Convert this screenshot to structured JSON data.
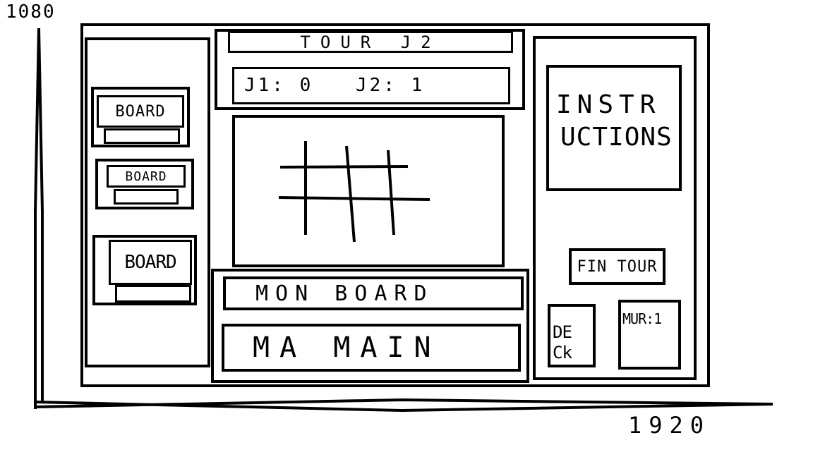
{
  "axes": {
    "y_label": "1080",
    "x_label": "1920"
  },
  "left_panel": {
    "boards": [
      {
        "label": "BOARD"
      },
      {
        "label": "BOARD"
      },
      {
        "label": "BOARD"
      }
    ]
  },
  "header": {
    "turn": "TOUR J2",
    "score_j1": "J1: 0",
    "score_j2": "J2: 1"
  },
  "bottom": {
    "my_board": "MON BOARD",
    "my_hand": "MA MAIN"
  },
  "right_panel": {
    "instructions_line1": "INSTR",
    "instructions_line2": "UCTIONS",
    "end_turn": "FIN TOUR",
    "deck_line1": "DE",
    "deck_line2": "Ck",
    "wall": "MUR:1"
  }
}
